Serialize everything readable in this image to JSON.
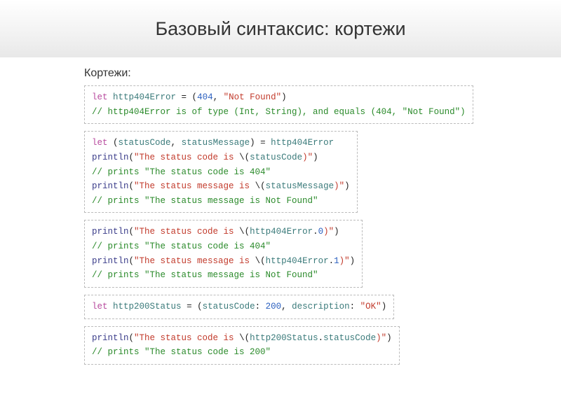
{
  "title": "Базовый синтаксис: кортежи",
  "subhead": "Кортежи:",
  "box1": {
    "l1": {
      "let": "let",
      "id": "http404Error",
      "eq": " = (",
      "n1": "404",
      "c": ", ",
      "s1": "\"Not Found\"",
      "close": ")"
    },
    "l2": {
      "cm": "// http404Error is of type (Int, String), and equals (404, \"Not Found\")"
    }
  },
  "box2": {
    "l1": {
      "let": "let",
      "open": " (",
      "a": "statusCode",
      "c1": ", ",
      "b": "statusMessage",
      "close": ") = ",
      "rhs": "http404Error"
    },
    "l2": {
      "fn": "println",
      "open": "(",
      "s1": "\"The status code is ",
      "esc": "\\(",
      "var": "statusCode",
      "s2": ")\"",
      "close": ")"
    },
    "l3": {
      "cm": "// prints \"The status code is 404\""
    },
    "l4": {
      "fn": "println",
      "open": "(",
      "s1": "\"The status message is ",
      "esc": "\\(",
      "var": "statusMessage",
      "s2": ")\"",
      "close": ")"
    },
    "l5": {
      "cm": "// prints \"The status message is Not Found\""
    }
  },
  "box3": {
    "l1": {
      "fn": "println",
      "open": "(",
      "s1": "\"The status code is ",
      "esc": "\\(",
      "var": "http404Error",
      "dot": ".",
      "idx": "0",
      "s2": ")\"",
      "close": ")"
    },
    "l2": {
      "cm": "// prints \"The status code is 404\""
    },
    "l3": {
      "fn": "println",
      "open": "(",
      "s1": "\"The status message is ",
      "esc": "\\(",
      "var": "http404Error",
      "dot": ".",
      "idx": "1",
      "s2": ")\"",
      "close": ")"
    },
    "l4": {
      "cm": "// prints \"The status message is Not Found\""
    }
  },
  "box4": {
    "l1": {
      "let": "let",
      "id": "http200Status",
      "eq": " = (",
      "k1": "statusCode",
      "c1": ": ",
      "n1": "200",
      "c2": ", ",
      "k2": "description",
      "c3": ": ",
      "s1": "\"OK\"",
      "close": ")"
    }
  },
  "box5": {
    "l1": {
      "fn": "println",
      "open": "(",
      "s1": "\"The status code is ",
      "esc": "\\(",
      "var": "http200Status",
      "dot": ".",
      "prop": "statusCode",
      "s2": ")\"",
      "close": ")"
    },
    "l2": {
      "cm": "// prints \"The status code is 200\""
    }
  }
}
